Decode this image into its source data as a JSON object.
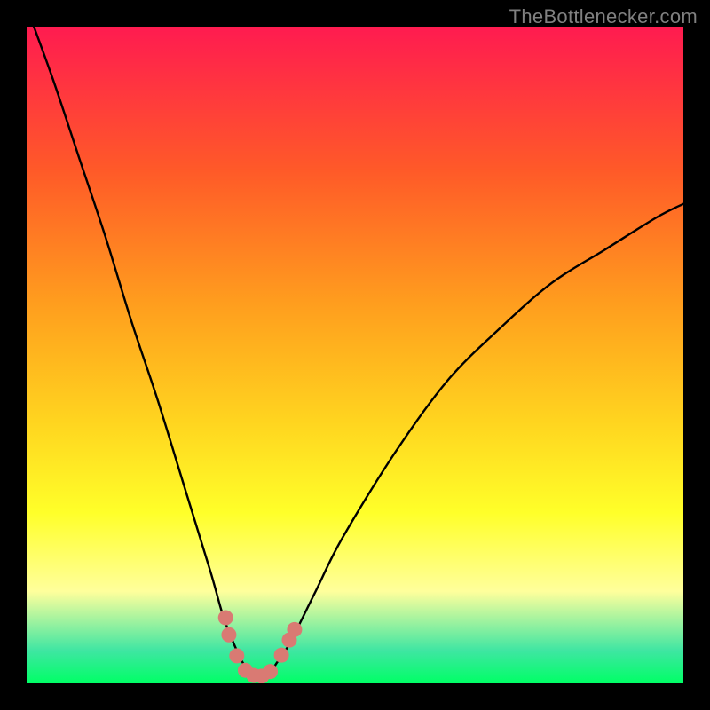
{
  "watermark": "TheBottlenecker.com",
  "colors": {
    "gradient_top": "#ff1b50",
    "gradient_mid1": "#ff5a28",
    "gradient_mid2": "#ff9d1e",
    "gradient_mid3": "#ffd41f",
    "gradient_yellow": "#ffff29",
    "gradient_lightyellow": "#ffff9c",
    "gradient_teal": "#3fe6a2",
    "gradient_green": "#00ff66",
    "curve": "#000000",
    "markers": "#d97a73",
    "frame_bg": "#000000"
  },
  "chart_data": {
    "type": "line",
    "title": "",
    "xlabel": "",
    "ylabel": "",
    "xlim": [
      0,
      100
    ],
    "ylim": [
      0,
      100
    ],
    "series": [
      {
        "name": "bottleneck-curve",
        "x": [
          0,
          4,
          8,
          12,
          16,
          20,
          24,
          28,
          30,
          32,
          33,
          34,
          35,
          36,
          37,
          38,
          40,
          44,
          48,
          56,
          64,
          72,
          80,
          88,
          96,
          100
        ],
        "y": [
          103,
          92,
          80,
          68,
          55,
          43,
          30,
          17,
          10,
          5,
          3,
          1.5,
          1,
          1,
          1.5,
          3,
          6,
          14,
          22,
          35,
          46,
          54,
          61,
          66,
          71,
          73
        ]
      }
    ],
    "markers": {
      "name": "bottleneck-points",
      "points": [
        {
          "x": 30.3,
          "y": 10.0
        },
        {
          "x": 30.8,
          "y": 7.4
        },
        {
          "x": 32.0,
          "y": 4.2
        },
        {
          "x": 33.3,
          "y": 2.0
        },
        {
          "x": 34.6,
          "y": 1.2
        },
        {
          "x": 35.8,
          "y": 1.1
        },
        {
          "x": 37.1,
          "y": 1.8
        },
        {
          "x": 38.8,
          "y": 4.3
        },
        {
          "x": 40.0,
          "y": 6.6
        },
        {
          "x": 40.8,
          "y": 8.2
        }
      ]
    }
  }
}
